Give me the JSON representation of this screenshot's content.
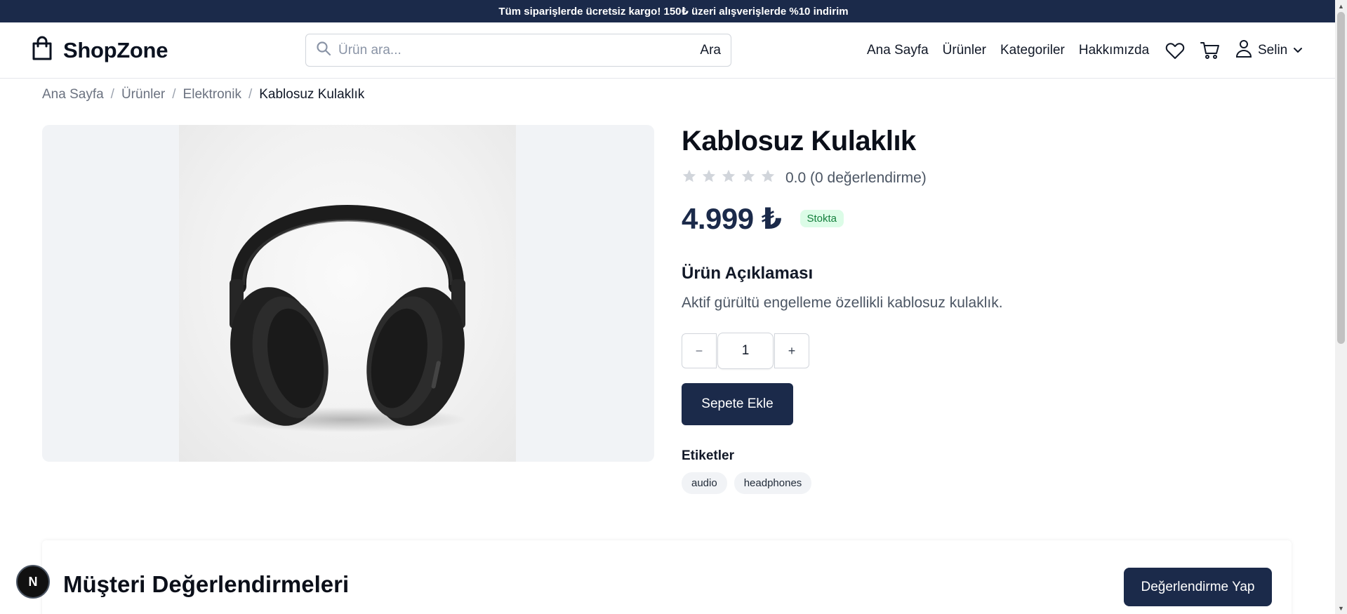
{
  "announcement": "Tüm siparişlerde ücretsiz kargo! 150₺ üzeri alışverişlerde %10 indirim",
  "header": {
    "logo_text": "ShopZone",
    "search": {
      "placeholder": "Ürün ara...",
      "button_label": "Ara",
      "value": ""
    },
    "nav": [
      "Ana Sayfa",
      "Ürünler",
      "Kategoriler",
      "Hakkımızda"
    ],
    "user_name": "Selin",
    "icons": [
      "shopping-bag-icon",
      "search-icon",
      "heart-icon",
      "cart-icon",
      "user-icon",
      "chevron-down-icon"
    ]
  },
  "breadcrumb": [
    "Ana Sayfa",
    "Ürünler",
    "Elektronik",
    "Kablosuz Kulaklık"
  ],
  "product": {
    "title": "Kablosuz Kulaklık",
    "rating_value": 0.0,
    "max_stars": 5,
    "rating_text": "0.0 (0 değerlendirme)",
    "price": "4.999 ₺",
    "stock_badge": "Stokta",
    "description_title": "Ürün Açıklaması",
    "description": "Aktif gürültü engelleme özellikli kablosuz kulaklık.",
    "quantity": "1",
    "minus_label": "−",
    "plus_label": "+",
    "add_to_cart": "Sepete Ekle",
    "tags_title": "Etiketler",
    "tags": [
      "audio",
      "headphones"
    ]
  },
  "reviews": {
    "title": "Müşteri Değerlendirmeleri",
    "button": "Değerlendirme Yap"
  },
  "next_badge": "N",
  "colors": {
    "brand_navy": "#1b2a4a",
    "stock_green_bg": "#dcfce7",
    "stock_green_text": "#15803d",
    "star_empty": "#d1d5db"
  }
}
